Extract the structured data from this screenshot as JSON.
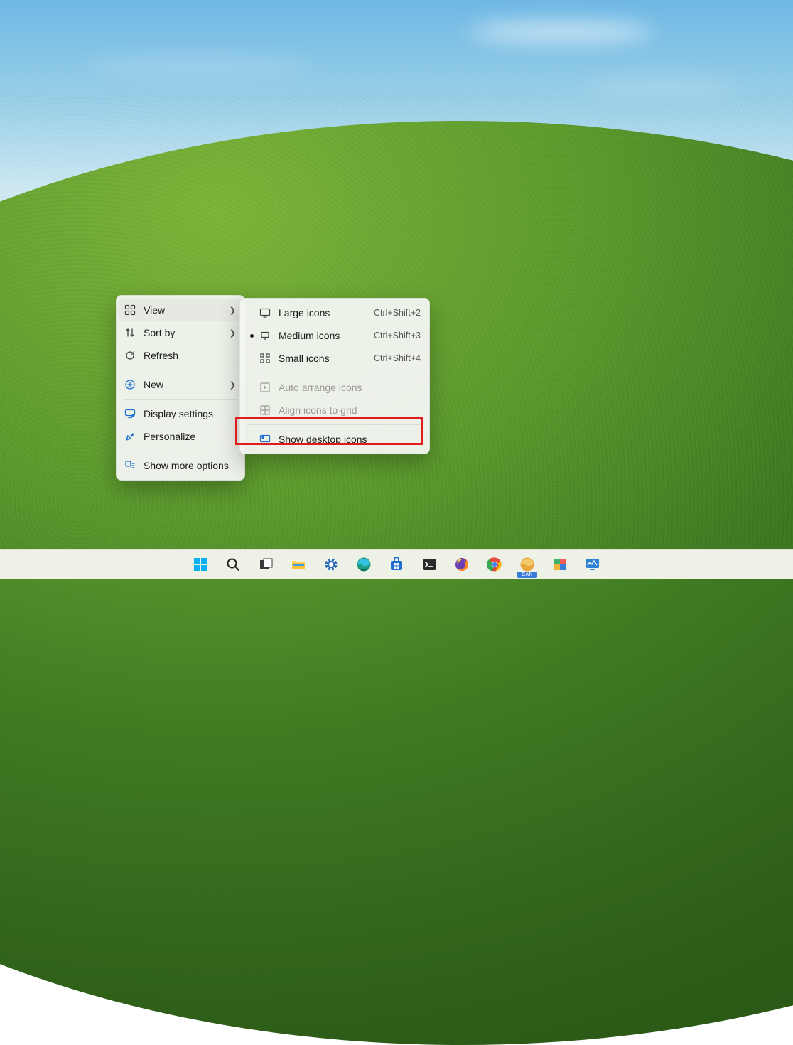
{
  "context_menu": {
    "items": [
      {
        "label": "View",
        "icon": "grid-icon",
        "submenu": true
      },
      {
        "label": "Sort by",
        "icon": "sort-icon",
        "submenu": true
      },
      {
        "label": "Refresh",
        "icon": "refresh-icon",
        "submenu": false
      },
      {
        "label": "New",
        "icon": "new-icon",
        "submenu": true
      },
      {
        "label": "Display settings",
        "icon": "display-icon",
        "submenu": false
      },
      {
        "label": "Personalize",
        "icon": "paint-icon",
        "submenu": false
      },
      {
        "label": "Show more options",
        "icon": "more-icon",
        "submenu": false
      }
    ]
  },
  "view_submenu": {
    "items": [
      {
        "label": "Large icons",
        "shortcut": "Ctrl+Shift+2",
        "icon": "monitor-large-icon",
        "selected": false,
        "disabled": false
      },
      {
        "label": "Medium icons",
        "shortcut": "Ctrl+Shift+3",
        "icon": "monitor-medium-icon",
        "selected": true,
        "disabled": false
      },
      {
        "label": "Small icons",
        "shortcut": "Ctrl+Shift+4",
        "icon": "grid-small-icon",
        "selected": false,
        "disabled": false
      },
      {
        "label": "Auto arrange icons",
        "shortcut": "",
        "icon": "arrange-icon",
        "selected": false,
        "disabled": true
      },
      {
        "label": "Align icons to grid",
        "shortcut": "",
        "icon": "align-grid-icon",
        "selected": false,
        "disabled": true
      },
      {
        "label": "Show desktop icons",
        "shortcut": "",
        "icon": "desktop-icons-icon",
        "selected": false,
        "disabled": false,
        "highlighted": true
      }
    ]
  },
  "taskbar": {
    "items": [
      {
        "name": "start",
        "icon": "windows-icon"
      },
      {
        "name": "search",
        "icon": "search-icon"
      },
      {
        "name": "task-view",
        "icon": "taskview-icon"
      },
      {
        "name": "file-explorer",
        "icon": "folder-icon"
      },
      {
        "name": "settings",
        "icon": "gear-icon"
      },
      {
        "name": "edge",
        "icon": "edge-icon"
      },
      {
        "name": "microsoft-store",
        "icon": "store-icon"
      },
      {
        "name": "terminal",
        "icon": "terminal-icon"
      },
      {
        "name": "firefox",
        "icon": "firefox-icon"
      },
      {
        "name": "chrome",
        "icon": "chrome-icon"
      },
      {
        "name": "edge-canary",
        "icon": "edge-canary-icon",
        "badge": "CAN"
      },
      {
        "name": "power-toys",
        "icon": "puzzle-icon"
      },
      {
        "name": "system-monitor",
        "icon": "monitor-app-icon"
      }
    ]
  }
}
